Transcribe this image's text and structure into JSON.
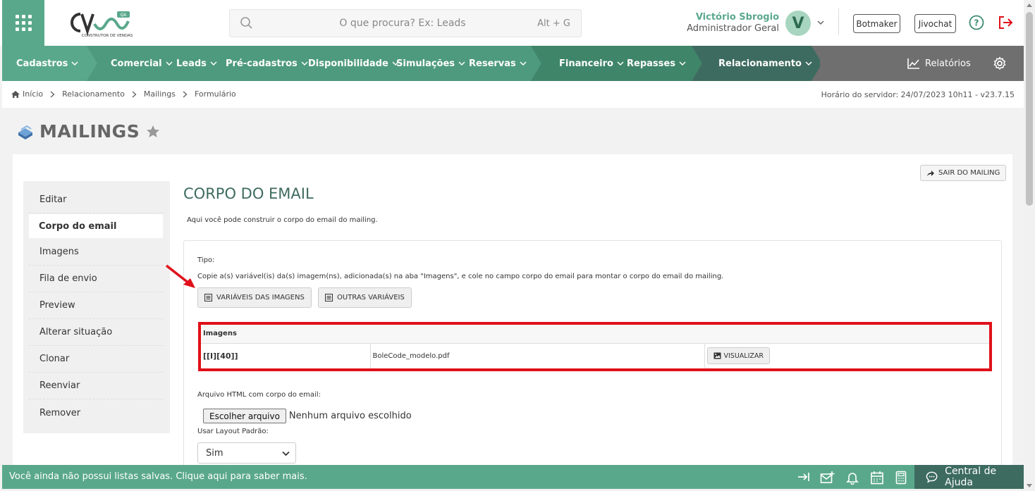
{
  "header": {
    "search_placeholder": "O que procura? Ex: Leads",
    "search_shortcut": "Alt + G",
    "user_name": "Victório Sbrogio",
    "user_role": "Administrador Geral",
    "avatar_letter": "V",
    "botmaker_label": "Botmaker",
    "jivochat_label": "Jivochat",
    "brand_color": "#5aa88c"
  },
  "nav": {
    "items": [
      {
        "label": "Cadastros"
      },
      {
        "label": "Comercial"
      },
      {
        "label": "Leads"
      },
      {
        "label": "Pré-cadastros"
      },
      {
        "label": "Disponibilidade"
      },
      {
        "label": "Simulações"
      },
      {
        "label": "Reservas"
      },
      {
        "label": "Financeiro"
      },
      {
        "label": "Repasses"
      },
      {
        "label": "Relacionamento"
      }
    ],
    "reports_label": "Relatórios"
  },
  "breadcrumb": {
    "items": [
      "Início",
      "Relacionamento",
      "Mailings",
      "Formulário"
    ],
    "server_time": "Horário do servidor: 24/07/2023 10h11 - v23.7.15"
  },
  "page": {
    "title": "MAILINGS"
  },
  "sidebar": {
    "items": [
      {
        "label": "Editar"
      },
      {
        "label": "Corpo do email"
      },
      {
        "label": "Imagens"
      },
      {
        "label": "Fila de envio"
      },
      {
        "label": "Preview"
      },
      {
        "label": "Alterar situação"
      },
      {
        "label": "Clonar"
      },
      {
        "label": "Reenviar"
      },
      {
        "label": "Remover"
      }
    ],
    "active_index": 1
  },
  "content": {
    "exit_button": "SAIR DO MAILING",
    "section_title": "CORPO DO EMAIL",
    "section_subtitle": "Aqui você pode construir o corpo do email do mailing.",
    "tipo_label": "Tipo:",
    "instructions": "Copie a(s) variável(is) da(s) imagem(ns), adicionada(s) na aba \"Imagens\", e cole no campo corpo do email para montar o corpo do email do mailing.",
    "var_images_button": "VARIÁVEIS DAS IMAGENS",
    "other_vars_button": "OUTRAS VARIÁVEIS",
    "images_table": {
      "header": "Imagens",
      "rows": [
        {
          "variable": "[[I][40]]",
          "file": "BoleCode_modelo.pdf",
          "action": "VISUALIZAR"
        }
      ]
    },
    "html_file_label": "Arquivo HTML com corpo do email:",
    "file_button": "Escolher arquivo",
    "file_status": "Nenhum arquivo escolhido",
    "layout_label": "Usar Layout Padrão:",
    "layout_value": "Sim"
  },
  "footer": {
    "message": "Você ainda não possui listas salvas. Clique aqui para saber mais.",
    "help_center": "Central de Ajuda"
  }
}
